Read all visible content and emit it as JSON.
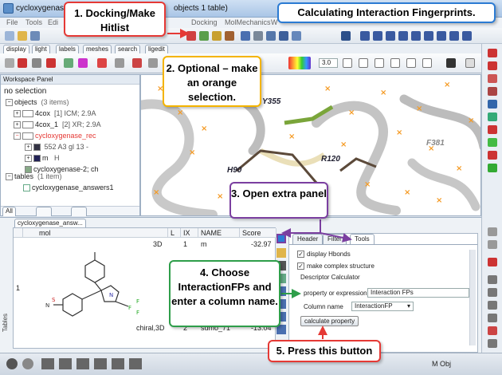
{
  "window": {
    "title_left": "cycloxygenase_re",
    "title_right": "objects 1 table)"
  },
  "menu": {
    "file": "File",
    "tools": "Tools",
    "edit": "Edi",
    "docking": "Docking",
    "molmechanics": "MolMechanics",
    "w": "W"
  },
  "tabs": {
    "display": "display",
    "light": "light",
    "labels": "labels",
    "meshes": "meshes",
    "search": "search",
    "ligedit": "ligedit"
  },
  "toolbar2": {
    "value": "3.0"
  },
  "workspace": {
    "title": "Workspace Panel",
    "no_selection": "no selection",
    "objects_label": "objects",
    "objects_count": "(3 items)",
    "obj1_name": "4cox",
    "obj1_info": "[1] ICM; 2.9A",
    "obj2_name": "4cox_1",
    "obj2_info": "[2] XR; 2.9A",
    "obj3_name": "cycloxygenase_rec",
    "sub1_info": "552 A3 gl 13 -",
    "sub2_m": "m",
    "sub2_h": "H",
    "sub3": "cycloxygenase-2; ch",
    "tables_label": "tables",
    "tables_count": "(1 item)",
    "table1": "cycloxygenase_answers1",
    "tab_all": "All"
  },
  "viewport": {
    "labels": [
      "H90",
      "R120",
      "Y355",
      "F381"
    ]
  },
  "bottom": {
    "tab": "cycloxygenase_answ...",
    "columns": {
      "mol": "mol",
      "l": "L",
      "ix": "IX",
      "name": "NAME",
      "score": "Score"
    },
    "row1": {
      "tag": "3D",
      "ix": "1",
      "name": "m",
      "score": "-32.97",
      "row_no": "1"
    },
    "row2": {
      "tag": "chiral,3D",
      "ix": "2",
      "name": "sumo_71",
      "score": "-13.04"
    },
    "side_label": "Tables"
  },
  "panel": {
    "tab_header": "Header",
    "tab_filter": "Filter",
    "tab_tools": "Tools",
    "display_hbonds": "display Hbonds",
    "complex_structure": "make complex structure",
    "descriptor_calc": "Descriptor Calculator",
    "property_label": "property or expression",
    "property_value": "Interaction FPs",
    "column_label": "Column name",
    "column_value": "InteractionFP",
    "calc_button": "calculate property"
  },
  "status": {
    "text": "M Obj"
  },
  "callouts": {
    "c1": "1. Docking/Make Hitlist",
    "c2": "2. Optional – make an orange selection.",
    "c3": "3. Open extra panel",
    "c4": "4. Choose InteractionFPs and enter a column name.",
    "c5": "5. Press this button",
    "title": "Calculating Interaction Fingerprints."
  },
  "colors": {
    "red": "#e53935",
    "orange": "#f4b400",
    "purple": "#7b3fa0",
    "green": "#2e9e4a",
    "blue": "#2b7bd3"
  }
}
